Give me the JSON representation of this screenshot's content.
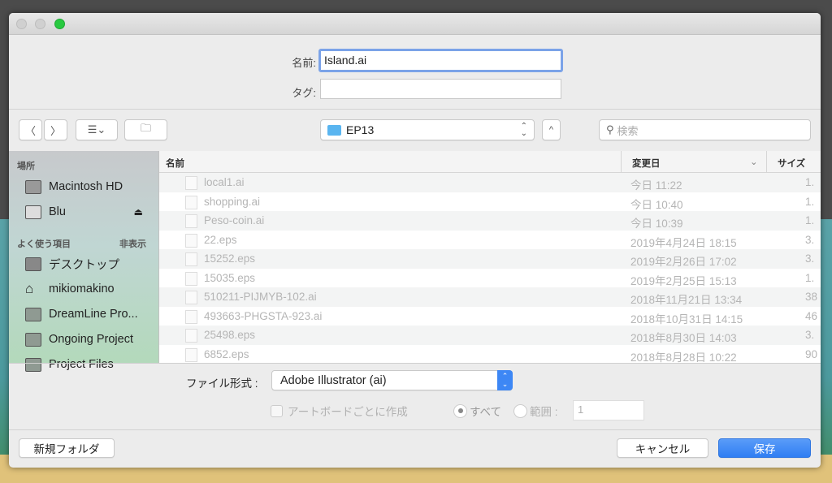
{
  "dialog": {
    "name_label": "名前:",
    "name_value": "Island.ai",
    "tag_label": "タグ:",
    "tag_value": "",
    "location": "EP13",
    "search_placeholder": "検索"
  },
  "sidebar": {
    "places_header": "場所",
    "places": [
      {
        "label": "Macintosh HD",
        "icon": "harddrive-icon"
      },
      {
        "label": "Blu",
        "icon": "external-drive-icon"
      }
    ],
    "favorites_header": "よく使う項目",
    "favorites_toggle": "非表示",
    "favorites": [
      {
        "label": "デスクトップ",
        "icon": "desktop-icon"
      },
      {
        "label": "mikiomakino",
        "icon": "home-icon"
      },
      {
        "label": "DreamLine Pro...",
        "icon": "folder-icon"
      },
      {
        "label": "Ongoing Project",
        "icon": "folder-icon"
      },
      {
        "label": "Project Files",
        "icon": "folder-icon"
      }
    ]
  },
  "list": {
    "columns": [
      "名前",
      "変更日",
      "サイズ"
    ],
    "rows": [
      {
        "name": "local1.ai",
        "date": "今日 11:22",
        "size": "1."
      },
      {
        "name": "shopping.ai",
        "date": "今日 10:40",
        "size": "1."
      },
      {
        "name": "Peso-coin.ai",
        "date": "今日 10:39",
        "size": "1."
      },
      {
        "name": "22.eps",
        "date": "2019年4月24日 18:15",
        "size": "3."
      },
      {
        "name": "15252.eps",
        "date": "2019年2月26日 17:02",
        "size": "3."
      },
      {
        "name": "15035.eps",
        "date": "2019年2月25日 15:13",
        "size": "1."
      },
      {
        "name": "510211-PIJMYB-102.ai",
        "date": "2018年11月21日 13:34",
        "size": "38"
      },
      {
        "name": "493663-PHGSTA-923.ai",
        "date": "2018年10月31日 14:15",
        "size": "46"
      },
      {
        "name": "25498.eps",
        "date": "2018年8月30日 14:03",
        "size": "3."
      },
      {
        "name": "6852.eps",
        "date": "2018年8月28日 10:22",
        "size": "90"
      }
    ]
  },
  "options": {
    "format_label": "ファイル形式 :",
    "format_value": "Adobe Illustrator (ai)",
    "artboard_label": "アートボードごとに作成",
    "all_label": "すべて",
    "range_label": "範囲 :",
    "range_value": "1"
  },
  "footer": {
    "new_folder": "新規フォルダ",
    "cancel": "キャンセル",
    "save": "保存"
  },
  "colors": {
    "accent": "#3d87f5",
    "traffic_green": "#28c940"
  }
}
